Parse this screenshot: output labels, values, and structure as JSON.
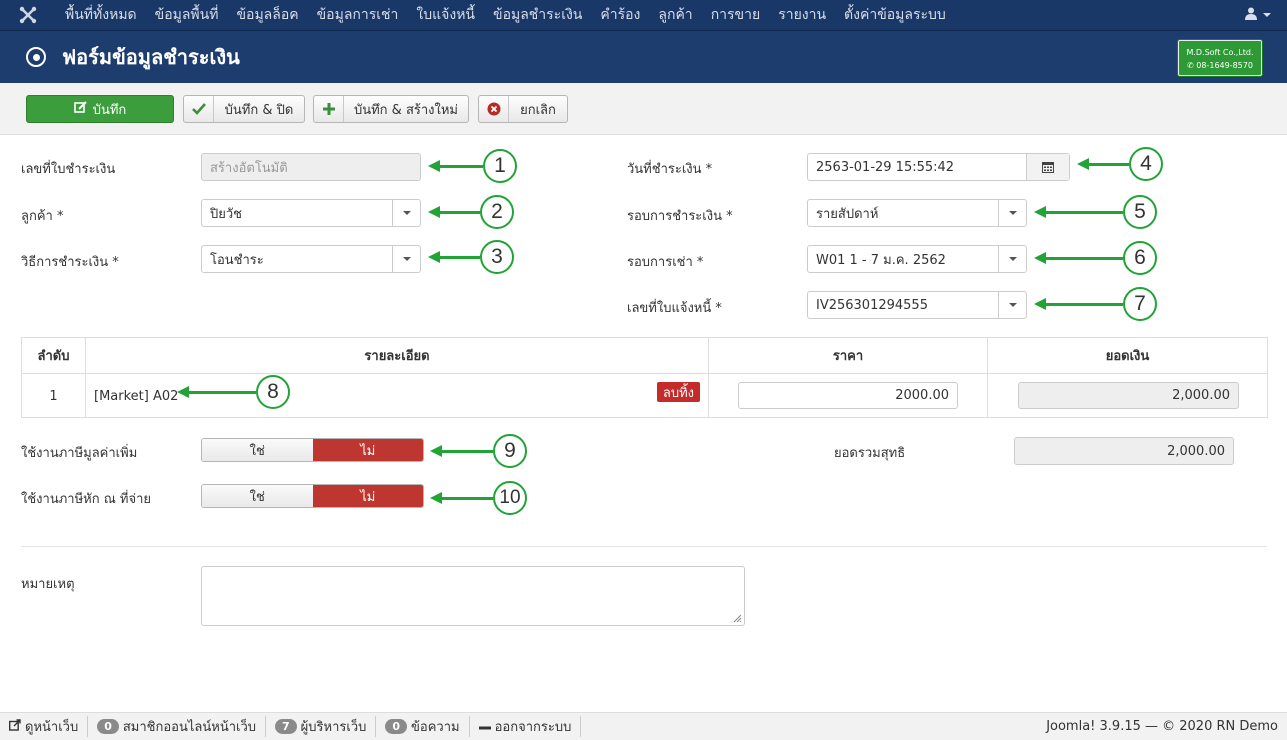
{
  "nav": {
    "logo_icon": "joomla-icon",
    "items": [
      "พื้นที่ทั้งหมด",
      "ข้อมูลพื้นที่",
      "ข้อมูลล็อค",
      "ข้อมูลการเช่า",
      "ใบแจ้งหนี้",
      "ข้อมูลชำระเงิน",
      "คำร้อง",
      "ลูกค้า",
      "การขาย",
      "รายงาน",
      "ตั้งค่าข้อมูลระบบ"
    ],
    "user_icon": "user-icon"
  },
  "header": {
    "title": "ฟอร์มข้อมูลชำระเงิน",
    "brand_line1": "M.D.Soft Co.,Ltd.",
    "brand_line2": "08-1649-8570"
  },
  "toolbar": {
    "save": "บันทึก",
    "save_close": "บันทึก & ปิด",
    "save_new": "บันทึก & สร้างใหม่",
    "cancel": "ยกเลิก"
  },
  "form": {
    "payment_no_label": "เลขที่ใบชำระเงิน",
    "payment_no_placeholder": "สร้างอัตโนมัติ",
    "customer_label": "ลูกค้า *",
    "customer_value": "ปิยวัช",
    "method_label": "วิธีการชำระเงิน *",
    "method_value": "โอนชำระ",
    "date_label": "วันที่ชำระเงิน *",
    "date_value": "2563-01-29 15:55:42",
    "cycle_label": "รอบการชำระเงิน *",
    "cycle_value": "รายสัปดาห์",
    "rent_cycle_label": "รอบการเช่า *",
    "rent_cycle_value": "W01 1 - 7 ม.ค. 2562",
    "invoice_label": "เลขที่ใบแจ้งหนี้ *",
    "invoice_value": "IV256301294555"
  },
  "table": {
    "headers": [
      "ลำดับ",
      "รายละเอียด",
      "ราคา",
      "ยอดเงิน"
    ],
    "rows": [
      {
        "no": "1",
        "detail": "[Market] A02",
        "delete": "ลบทิ้ง",
        "price": "2000.00",
        "amount": "2,000.00"
      }
    ]
  },
  "vat": {
    "label": "ใช้งานภาษีมูลค่าเพิ่ม",
    "yes": "ใช่",
    "no": "ไม่",
    "selected": "ไม่"
  },
  "wht": {
    "label": "ใช้งานภาษีหัก ณ ที่จ่าย",
    "yes": "ใช่",
    "no": "ไม่",
    "selected": "ไม่"
  },
  "net_total": {
    "label": "ยอดรวมสุทธิ",
    "value": "2,000.00"
  },
  "note": {
    "label": "หมายเหตุ",
    "value": ""
  },
  "annotations": [
    "1",
    "2",
    "3",
    "4",
    "5",
    "6",
    "7",
    "8",
    "9",
    "10"
  ],
  "statusbar": {
    "view_site": "ดูหน้าเว็บ",
    "online_count": "0",
    "online_label": "สมาชิกออนไลน์หน้าเว็บ",
    "admin_count": "7",
    "admin_label": "ผู้บริหารเว็บ",
    "msg_count": "0",
    "msg_label": "ข้อความ",
    "logout": "ออกจากระบบ",
    "copyright": "Joomla! 3.9.15 — © 2020 RN Demo"
  },
  "colors": {
    "nav_bg": "#1a3867",
    "title_bg": "#1d3d6e",
    "save_green": "#3c9d3c",
    "toggle_red": "#bd362f",
    "annotation_green": "#21a336"
  }
}
